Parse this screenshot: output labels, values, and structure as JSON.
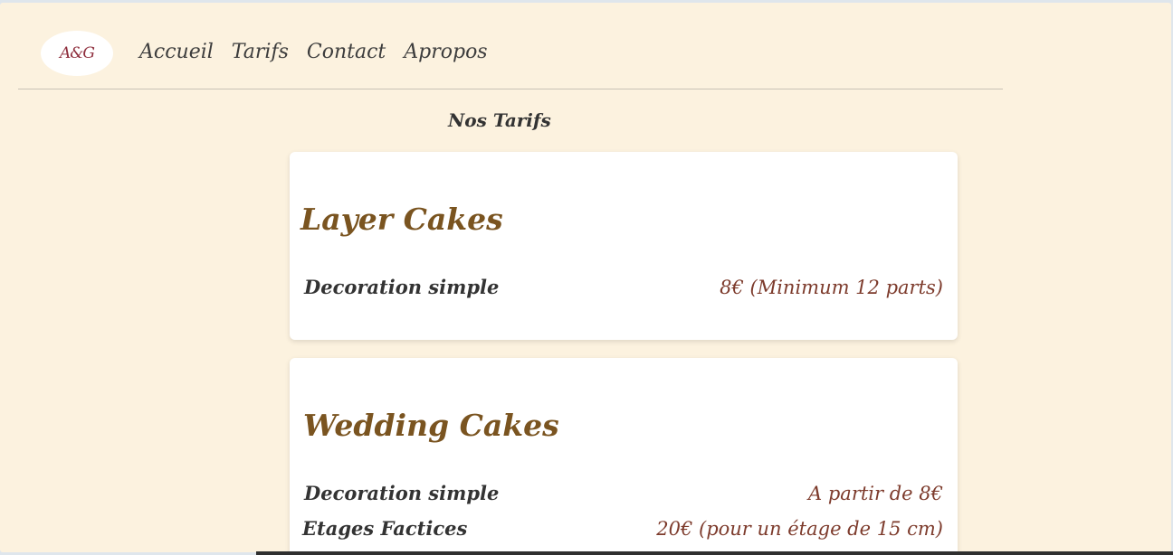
{
  "header": {
    "logo_text": "A&G",
    "nav": [
      {
        "label": "Accueil"
      },
      {
        "label": "Tarifs"
      },
      {
        "label": "Contact"
      },
      {
        "label": "Apropos"
      }
    ]
  },
  "main": {
    "title": "Nos Tarifs",
    "cards": [
      {
        "title": "Layer Cakes",
        "rows": [
          {
            "name": "Decoration simple",
            "price": "8€ (Minimum 12 parts)"
          }
        ]
      },
      {
        "title": "Wedding Cakes",
        "rows": [
          {
            "name": "Decoration simple",
            "price": "A partir de 8€"
          },
          {
            "name": "Etages Factices",
            "price": "20€ (pour un étage de 15 cm)"
          }
        ]
      }
    ]
  },
  "colors": {
    "page_background": "#fcf2df",
    "card_background": "#ffffff",
    "card_title": "#7a5420",
    "price_text": "#7d3b2c",
    "label_text": "#333333"
  }
}
